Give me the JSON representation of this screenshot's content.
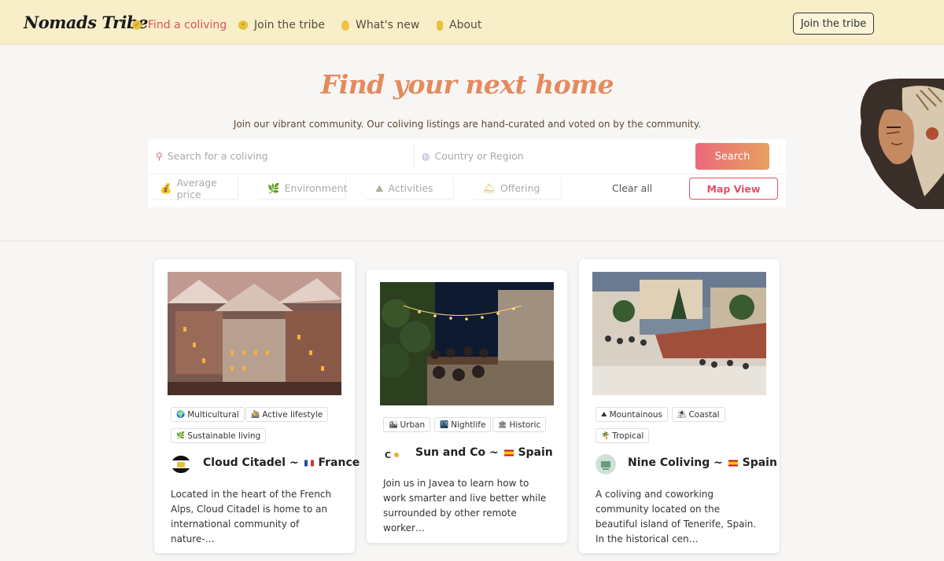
{
  "header": {
    "logo": "Nomads Tribe",
    "nav": [
      {
        "label": "Find a coliving",
        "icon": "coin-icon",
        "active": true
      },
      {
        "label": "Join the tribe",
        "icon": "smiley-icon",
        "active": false
      },
      {
        "label": "What's new",
        "icon": "drop-icon",
        "active": false
      },
      {
        "label": "About",
        "icon": "microphone-icon",
        "active": false
      }
    ],
    "cta": "Join the tribe"
  },
  "hero": {
    "title": "Find your next home",
    "subtitle": "Join our vibrant community. Our coliving listings are hand-curated and voted on by the community."
  },
  "search": {
    "coliving_placeholder": "Search for a coliving",
    "region_placeholder": "Country or Region",
    "button": "Search",
    "filters": [
      {
        "label": "Average price",
        "icon": "money-bag-icon"
      },
      {
        "label": "Environment",
        "icon": "leaf-icon"
      },
      {
        "label": "Activities",
        "icon": "mountain-bike-icon"
      },
      {
        "label": "Offering",
        "icon": "bell-icon"
      }
    ],
    "clear_all": "Clear all",
    "map_view": "Map View"
  },
  "cards": [
    {
      "tags": [
        "Multicultural",
        "Active lifestyle",
        "Sustainable living"
      ],
      "tag_icons": [
        "globe-icon",
        "bike-icon",
        "leaf-icon"
      ],
      "name": "Cloud Citadel",
      "separator": "~",
      "country": "France",
      "flag": "france-flag-icon",
      "description": "Located in the heart of the French Alps, Cloud Citadel is home to an international community of nature-…"
    },
    {
      "tags": [
        "Urban",
        "Nightlife",
        "Historic"
      ],
      "tag_icons": [
        "city-icon",
        "night-city-icon",
        "building-icon"
      ],
      "name": "Sun and Co",
      "separator": "~",
      "country": "Spain",
      "flag": "spain-flag-icon",
      "description": "Join us in Javea to learn how to work smarter and live better while surrounded by other remote worker…"
    },
    {
      "tags": [
        "Mountainous",
        "Coastal",
        "Tropical"
      ],
      "tag_icons": [
        "mountain-icon",
        "beach-umbrella-icon",
        "palm-tree-icon"
      ],
      "name": "Nine Coliving",
      "separator": "~",
      "country": "Spain",
      "flag": "spain-flag-icon",
      "description": "A coliving and coworking community located on the beautiful island of Tenerife, Spain. In the historical cen…"
    }
  ],
  "colors": {
    "header_bg": "#f8efc9",
    "accent_red": "#e0505a",
    "title_orange": "#e58a5e",
    "search_gradient_start": "#ea6a7a",
    "search_gradient_end": "#e8a060"
  }
}
